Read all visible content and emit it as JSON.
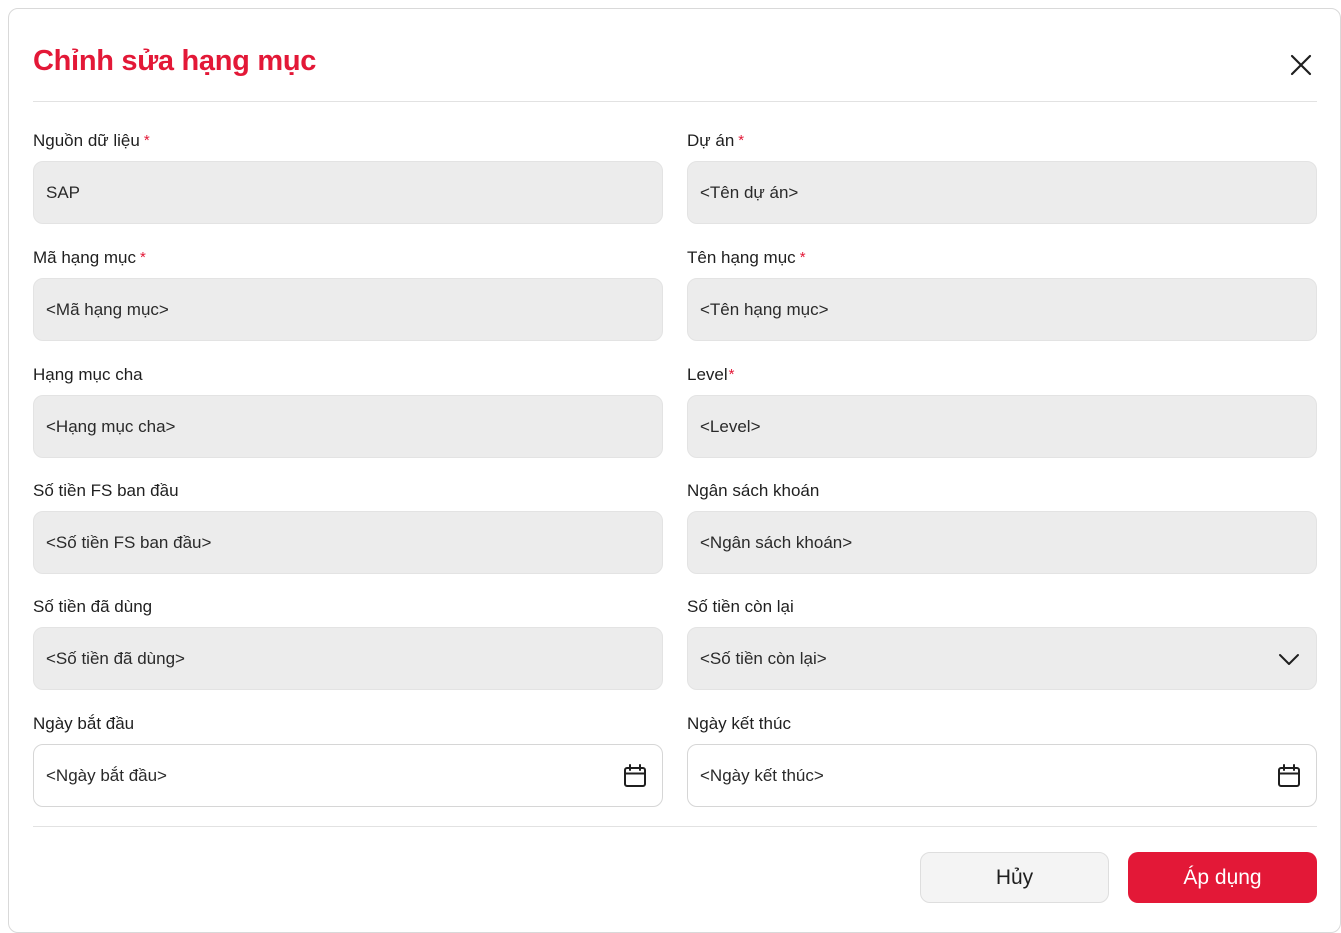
{
  "dialog": {
    "title": "Chỉnh sửa hạng mục",
    "close_icon": "close-icon"
  },
  "fields": {
    "data_source": {
      "label": "Nguồn dữ liệu",
      "required": "*",
      "value": "SAP"
    },
    "project": {
      "label": "Dự án",
      "required": "*",
      "placeholder": "<Tên dự án>"
    },
    "item_code": {
      "label": "Mã hạng mục",
      "required": "*",
      "placeholder": "<Mã hạng mục>"
    },
    "item_name": {
      "label": "Tên hạng mục",
      "required": "*",
      "placeholder": "<Tên hạng mục>"
    },
    "parent_item": {
      "label": "Hạng mục cha",
      "placeholder": "<Hạng mục cha>"
    },
    "level": {
      "label": "Level",
      "required": "*",
      "placeholder": "<Level>"
    },
    "initial_fs_amount": {
      "label": "Số tiền FS ban đầu",
      "placeholder": "<Số tiền FS ban đầu>"
    },
    "lump_sum_budget": {
      "label": "Ngân sách khoán",
      "placeholder": "<Ngân sách khoán>"
    },
    "amount_used": {
      "label": "Số tiền đã dùng",
      "placeholder": "<Số tiền đã dùng>"
    },
    "amount_remaining": {
      "label": "Số tiền còn lại",
      "placeholder": "<Số tiền còn lại>",
      "icon": "chevron-down-icon"
    },
    "start_date": {
      "label": "Ngày bắt đầu",
      "placeholder": "<Ngày bắt đầu>",
      "icon": "calendar-icon"
    },
    "end_date": {
      "label": "Ngày kết thúc",
      "placeholder": "<Ngày kết thúc>",
      "icon": "calendar-icon"
    }
  },
  "footer": {
    "cancel_label": "Hủy",
    "apply_label": "Áp dụng"
  },
  "colors": {
    "accent": "#e31837",
    "disabled_bg": "#ececec",
    "border": "#d6d6d6"
  }
}
